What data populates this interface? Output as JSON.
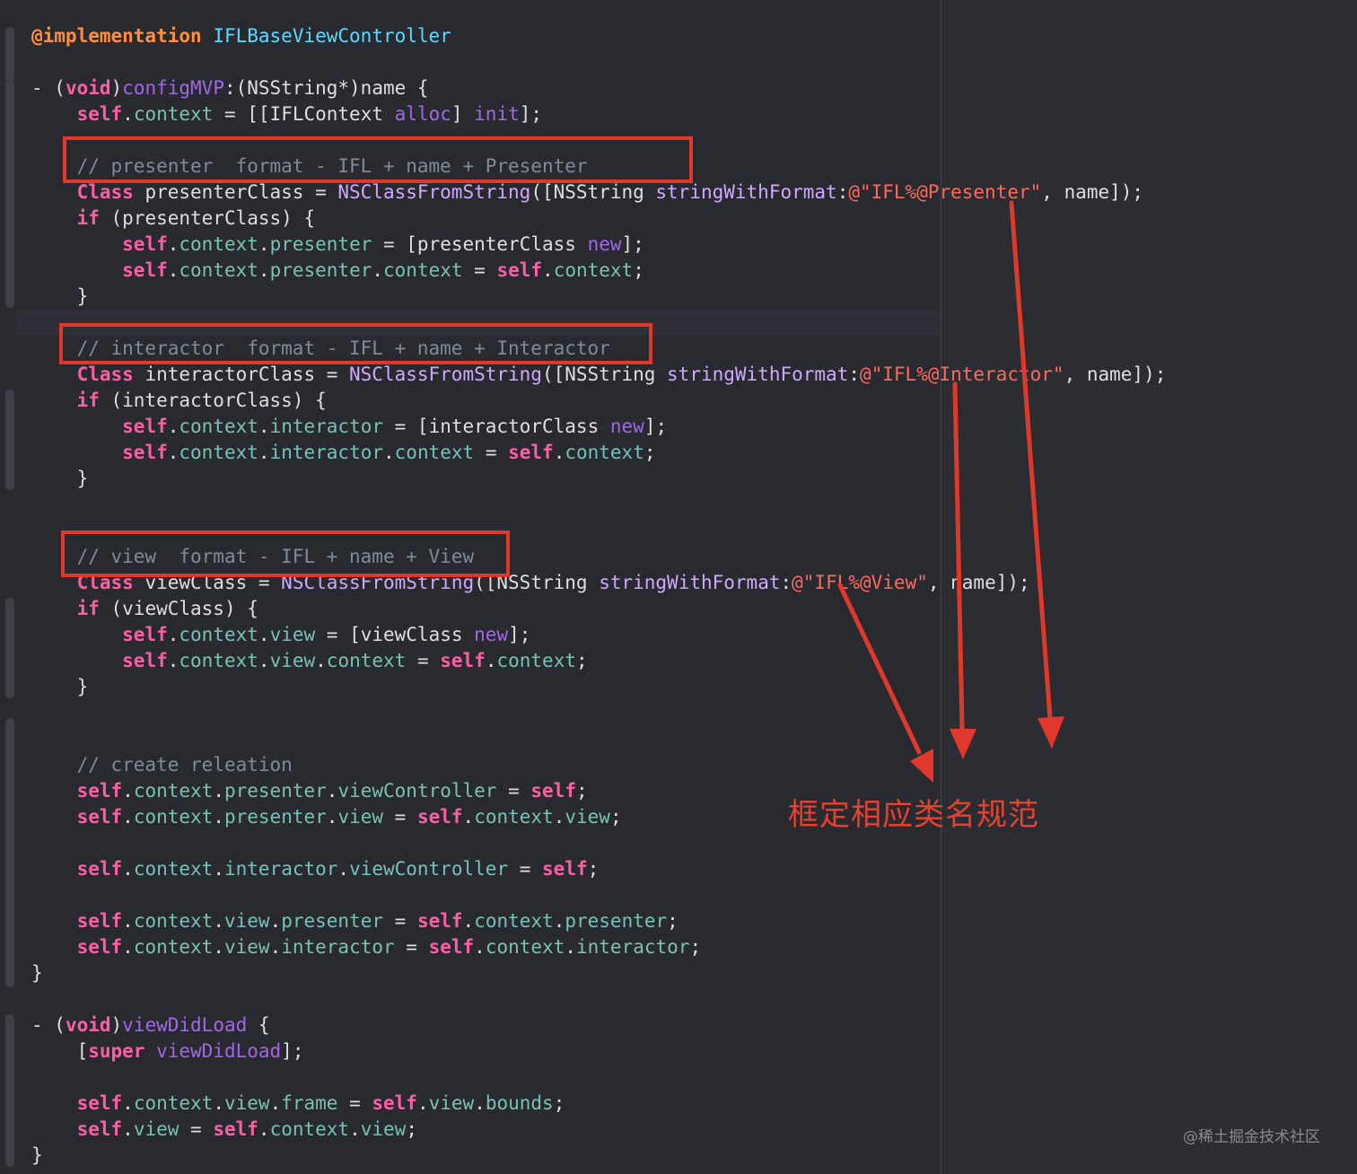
{
  "annotation": {
    "text": "框定相应类名规范",
    "color": "#e0392b"
  },
  "watermark": "@稀土掘金技术社区",
  "code_lines": [
    [
      [
        "dir",
        "@implementation"
      ],
      [
        "pl",
        " "
      ],
      [
        "typ",
        "IFLBaseViewController"
      ]
    ],
    [],
    [
      [
        "pl",
        "- ("
      ],
      [
        "kw",
        "void"
      ],
      [
        "pl",
        ")"
      ],
      [
        "fn",
        "configMVP"
      ],
      [
        "pl",
        ":(NSString*)name {"
      ]
    ],
    [
      [
        "pl",
        "    "
      ],
      [
        "kw",
        "self"
      ],
      [
        "pl",
        "."
      ],
      [
        "prop",
        "context"
      ],
      [
        "pl",
        " = [["
      ],
      [
        "pl",
        "IFLContext"
      ],
      [
        "pl",
        " "
      ],
      [
        "fn",
        "alloc"
      ],
      [
        "pl",
        "] "
      ],
      [
        "fn",
        "init"
      ],
      [
        "pl",
        "];"
      ]
    ],
    [],
    [
      [
        "pl",
        "    "
      ],
      [
        "cmt",
        "// presenter  format - IFL + name + Presenter"
      ]
    ],
    [
      [
        "pl",
        "    "
      ],
      [
        "kw",
        "Class"
      ],
      [
        "pl",
        " presenterClass = "
      ],
      [
        "cls",
        "NSClassFromString"
      ],
      [
        "pl",
        "([NSString "
      ],
      [
        "cls",
        "stringWithFormat"
      ],
      [
        "pl",
        ":"
      ],
      [
        "str",
        "@\"IFL%@Presenter\""
      ],
      [
        "pl",
        ", name]);"
      ]
    ],
    [
      [
        "pl",
        "    "
      ],
      [
        "kw",
        "if"
      ],
      [
        "pl",
        " (presenterClass) {"
      ]
    ],
    [
      [
        "pl",
        "        "
      ],
      [
        "kw",
        "self"
      ],
      [
        "pl",
        "."
      ],
      [
        "prop",
        "context"
      ],
      [
        "pl",
        "."
      ],
      [
        "prop",
        "presenter"
      ],
      [
        "pl",
        " = [presenterClass "
      ],
      [
        "fn",
        "new"
      ],
      [
        "pl",
        "];"
      ]
    ],
    [
      [
        "pl",
        "        "
      ],
      [
        "kw",
        "self"
      ],
      [
        "pl",
        "."
      ],
      [
        "prop",
        "context"
      ],
      [
        "pl",
        "."
      ],
      [
        "prop",
        "presenter"
      ],
      [
        "pl",
        "."
      ],
      [
        "prop",
        "context"
      ],
      [
        "pl",
        " = "
      ],
      [
        "kw",
        "self"
      ],
      [
        "pl",
        "."
      ],
      [
        "prop",
        "context"
      ],
      [
        "pl",
        ";"
      ]
    ],
    [
      [
        "pl",
        "    }"
      ]
    ],
    [],
    [
      [
        "pl",
        "    "
      ],
      [
        "cmt",
        "// interactor  format - IFL + name + Interactor"
      ]
    ],
    [
      [
        "pl",
        "    "
      ],
      [
        "kw",
        "Class"
      ],
      [
        "pl",
        " interactorClass = "
      ],
      [
        "cls",
        "NSClassFromString"
      ],
      [
        "pl",
        "([NSString "
      ],
      [
        "cls",
        "stringWithFormat"
      ],
      [
        "pl",
        ":"
      ],
      [
        "str",
        "@\"IFL%@Interactor\""
      ],
      [
        "pl",
        ", name]);"
      ]
    ],
    [
      [
        "pl",
        "    "
      ],
      [
        "kw",
        "if"
      ],
      [
        "pl",
        " (interactorClass) {"
      ]
    ],
    [
      [
        "pl",
        "        "
      ],
      [
        "kw",
        "self"
      ],
      [
        "pl",
        "."
      ],
      [
        "prop",
        "context"
      ],
      [
        "pl",
        "."
      ],
      [
        "prop",
        "interactor"
      ],
      [
        "pl",
        " = [interactorClass "
      ],
      [
        "fn",
        "new"
      ],
      [
        "pl",
        "];"
      ]
    ],
    [
      [
        "pl",
        "        "
      ],
      [
        "kw",
        "self"
      ],
      [
        "pl",
        "."
      ],
      [
        "prop",
        "context"
      ],
      [
        "pl",
        "."
      ],
      [
        "prop",
        "interactor"
      ],
      [
        "pl",
        "."
      ],
      [
        "prop",
        "context"
      ],
      [
        "pl",
        " = "
      ],
      [
        "kw",
        "self"
      ],
      [
        "pl",
        "."
      ],
      [
        "prop",
        "context"
      ],
      [
        "pl",
        ";"
      ]
    ],
    [
      [
        "pl",
        "    }"
      ]
    ],
    [],
    [],
    [
      [
        "pl",
        "    "
      ],
      [
        "cmt",
        "// view  format - IFL + name + View"
      ]
    ],
    [
      [
        "pl",
        "    "
      ],
      [
        "kw",
        "Class"
      ],
      [
        "pl",
        " viewClass = "
      ],
      [
        "cls",
        "NSClassFromString"
      ],
      [
        "pl",
        "([NSString "
      ],
      [
        "cls",
        "stringWithFormat"
      ],
      [
        "pl",
        ":"
      ],
      [
        "str",
        "@\"IFL%@View\""
      ],
      [
        "pl",
        ", name]);"
      ]
    ],
    [
      [
        "pl",
        "    "
      ],
      [
        "kw",
        "if"
      ],
      [
        "pl",
        " (viewClass) {"
      ]
    ],
    [
      [
        "pl",
        "        "
      ],
      [
        "kw",
        "self"
      ],
      [
        "pl",
        "."
      ],
      [
        "prop",
        "context"
      ],
      [
        "pl",
        "."
      ],
      [
        "prop",
        "view"
      ],
      [
        "pl",
        " = [viewClass "
      ],
      [
        "fn",
        "new"
      ],
      [
        "pl",
        "];"
      ]
    ],
    [
      [
        "pl",
        "        "
      ],
      [
        "kw",
        "self"
      ],
      [
        "pl",
        "."
      ],
      [
        "prop",
        "context"
      ],
      [
        "pl",
        "."
      ],
      [
        "prop",
        "view"
      ],
      [
        "pl",
        "."
      ],
      [
        "prop",
        "context"
      ],
      [
        "pl",
        " = "
      ],
      [
        "kw",
        "self"
      ],
      [
        "pl",
        "."
      ],
      [
        "prop",
        "context"
      ],
      [
        "pl",
        ";"
      ]
    ],
    [
      [
        "pl",
        "    }"
      ]
    ],
    [],
    [],
    [
      [
        "pl",
        "    "
      ],
      [
        "cmt",
        "// create releation"
      ]
    ],
    [
      [
        "pl",
        "    "
      ],
      [
        "kw",
        "self"
      ],
      [
        "pl",
        "."
      ],
      [
        "prop",
        "context"
      ],
      [
        "pl",
        "."
      ],
      [
        "prop",
        "presenter"
      ],
      [
        "pl",
        "."
      ],
      [
        "prop",
        "viewController"
      ],
      [
        "pl",
        " = "
      ],
      [
        "kw",
        "self"
      ],
      [
        "pl",
        ";"
      ]
    ],
    [
      [
        "pl",
        "    "
      ],
      [
        "kw",
        "self"
      ],
      [
        "pl",
        "."
      ],
      [
        "prop",
        "context"
      ],
      [
        "pl",
        "."
      ],
      [
        "prop",
        "presenter"
      ],
      [
        "pl",
        "."
      ],
      [
        "prop",
        "view"
      ],
      [
        "pl",
        " = "
      ],
      [
        "kw",
        "self"
      ],
      [
        "pl",
        "."
      ],
      [
        "prop",
        "context"
      ],
      [
        "pl",
        "."
      ],
      [
        "prop",
        "view"
      ],
      [
        "pl",
        ";"
      ]
    ],
    [],
    [
      [
        "pl",
        "    "
      ],
      [
        "kw",
        "self"
      ],
      [
        "pl",
        "."
      ],
      [
        "prop",
        "context"
      ],
      [
        "pl",
        "."
      ],
      [
        "prop",
        "interactor"
      ],
      [
        "pl",
        "."
      ],
      [
        "prop",
        "viewController"
      ],
      [
        "pl",
        " = "
      ],
      [
        "kw",
        "self"
      ],
      [
        "pl",
        ";"
      ]
    ],
    [],
    [
      [
        "pl",
        "    "
      ],
      [
        "kw",
        "self"
      ],
      [
        "pl",
        "."
      ],
      [
        "prop",
        "context"
      ],
      [
        "pl",
        "."
      ],
      [
        "prop",
        "view"
      ],
      [
        "pl",
        "."
      ],
      [
        "prop",
        "presenter"
      ],
      [
        "pl",
        " = "
      ],
      [
        "kw",
        "self"
      ],
      [
        "pl",
        "."
      ],
      [
        "prop",
        "context"
      ],
      [
        "pl",
        "."
      ],
      [
        "prop",
        "presenter"
      ],
      [
        "pl",
        ";"
      ]
    ],
    [
      [
        "pl",
        "    "
      ],
      [
        "kw",
        "self"
      ],
      [
        "pl",
        "."
      ],
      [
        "prop",
        "context"
      ],
      [
        "pl",
        "."
      ],
      [
        "prop",
        "view"
      ],
      [
        "pl",
        "."
      ],
      [
        "prop",
        "interactor"
      ],
      [
        "pl",
        " = "
      ],
      [
        "kw",
        "self"
      ],
      [
        "pl",
        "."
      ],
      [
        "prop",
        "context"
      ],
      [
        "pl",
        "."
      ],
      [
        "prop",
        "interactor"
      ],
      [
        "pl",
        ";"
      ]
    ],
    [
      [
        "pl",
        "}"
      ]
    ],
    [],
    [
      [
        "pl",
        "- ("
      ],
      [
        "kw",
        "void"
      ],
      [
        "pl",
        ")"
      ],
      [
        "fn",
        "viewDidLoad"
      ],
      [
        "pl",
        " {"
      ]
    ],
    [
      [
        "pl",
        "    ["
      ],
      [
        "kw",
        "super"
      ],
      [
        "pl",
        " "
      ],
      [
        "fn",
        "viewDidLoad"
      ],
      [
        "pl",
        "];"
      ]
    ],
    [],
    [
      [
        "pl",
        "    "
      ],
      [
        "kw",
        "self"
      ],
      [
        "pl",
        "."
      ],
      [
        "prop",
        "context"
      ],
      [
        "pl",
        "."
      ],
      [
        "prop",
        "view"
      ],
      [
        "pl",
        "."
      ],
      [
        "prop",
        "frame"
      ],
      [
        "pl",
        " = "
      ],
      [
        "kw",
        "self"
      ],
      [
        "pl",
        "."
      ],
      [
        "prop",
        "view"
      ],
      [
        "pl",
        "."
      ],
      [
        "prop",
        "bounds"
      ],
      [
        "pl",
        ";"
      ]
    ],
    [
      [
        "pl",
        "    "
      ],
      [
        "kw",
        "self"
      ],
      [
        "pl",
        "."
      ],
      [
        "prop",
        "view"
      ],
      [
        "pl",
        " = "
      ],
      [
        "kw",
        "self"
      ],
      [
        "pl",
        "."
      ],
      [
        "prop",
        "context"
      ],
      [
        "pl",
        "."
      ],
      [
        "prop",
        "view"
      ],
      [
        "pl",
        ";"
      ]
    ],
    [
      [
        "pl",
        "}"
      ]
    ]
  ]
}
